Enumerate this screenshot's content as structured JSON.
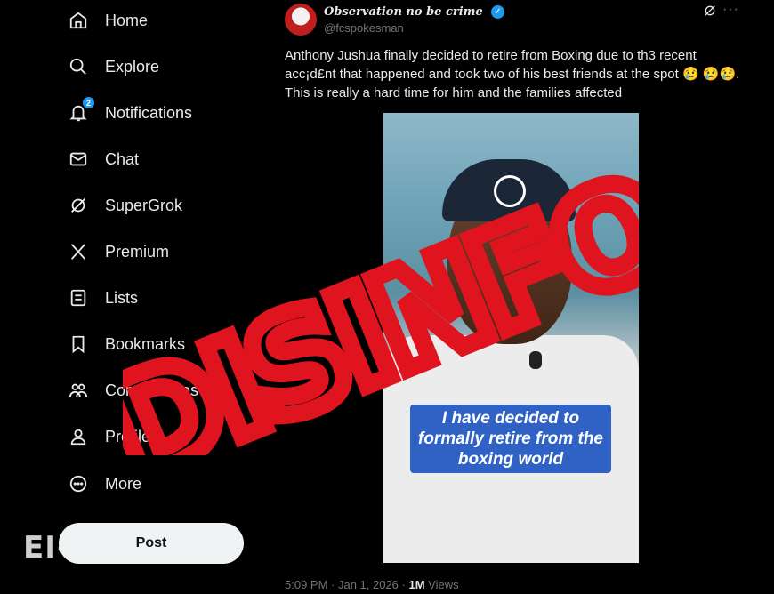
{
  "sidebar": {
    "items": [
      {
        "label": "Home",
        "icon": "home-icon"
      },
      {
        "label": "Explore",
        "icon": "search-icon"
      },
      {
        "label": "Notifications",
        "icon": "bell-icon",
        "badge": "2"
      },
      {
        "label": "Chat",
        "icon": "mail-icon"
      },
      {
        "label": "SuperGrok",
        "icon": "grok-icon"
      },
      {
        "label": "Premium",
        "icon": "x-logo-icon"
      },
      {
        "label": "Lists",
        "icon": "list-icon"
      },
      {
        "label": "Bookmarks",
        "icon": "bookmark-icon"
      },
      {
        "label": "Communities",
        "icon": "communities-icon"
      },
      {
        "label": "Profile",
        "icon": "profile-icon"
      },
      {
        "label": "More",
        "icon": "more-circle-icon"
      }
    ],
    "post_label": "Post"
  },
  "watermark": "EI-",
  "tweet": {
    "display_name": "Observation no be crime",
    "handle": "@fcspokesman",
    "text": "Anthony Jushua finally decided to retire from Boxing due to th3 recent acc¡d£nt that happened and took two of his best friends at the spot 😢 😢😢. This is really a hard time for him and the families affected",
    "media_caption": "I have decided to formally retire from the boxing world",
    "time": "5:09 PM · Jan 1, 2026 · ",
    "views_count": "1M",
    "views_label": " Views"
  },
  "stamp": {
    "text": "DISINFO",
    "color": "#e0141e"
  }
}
